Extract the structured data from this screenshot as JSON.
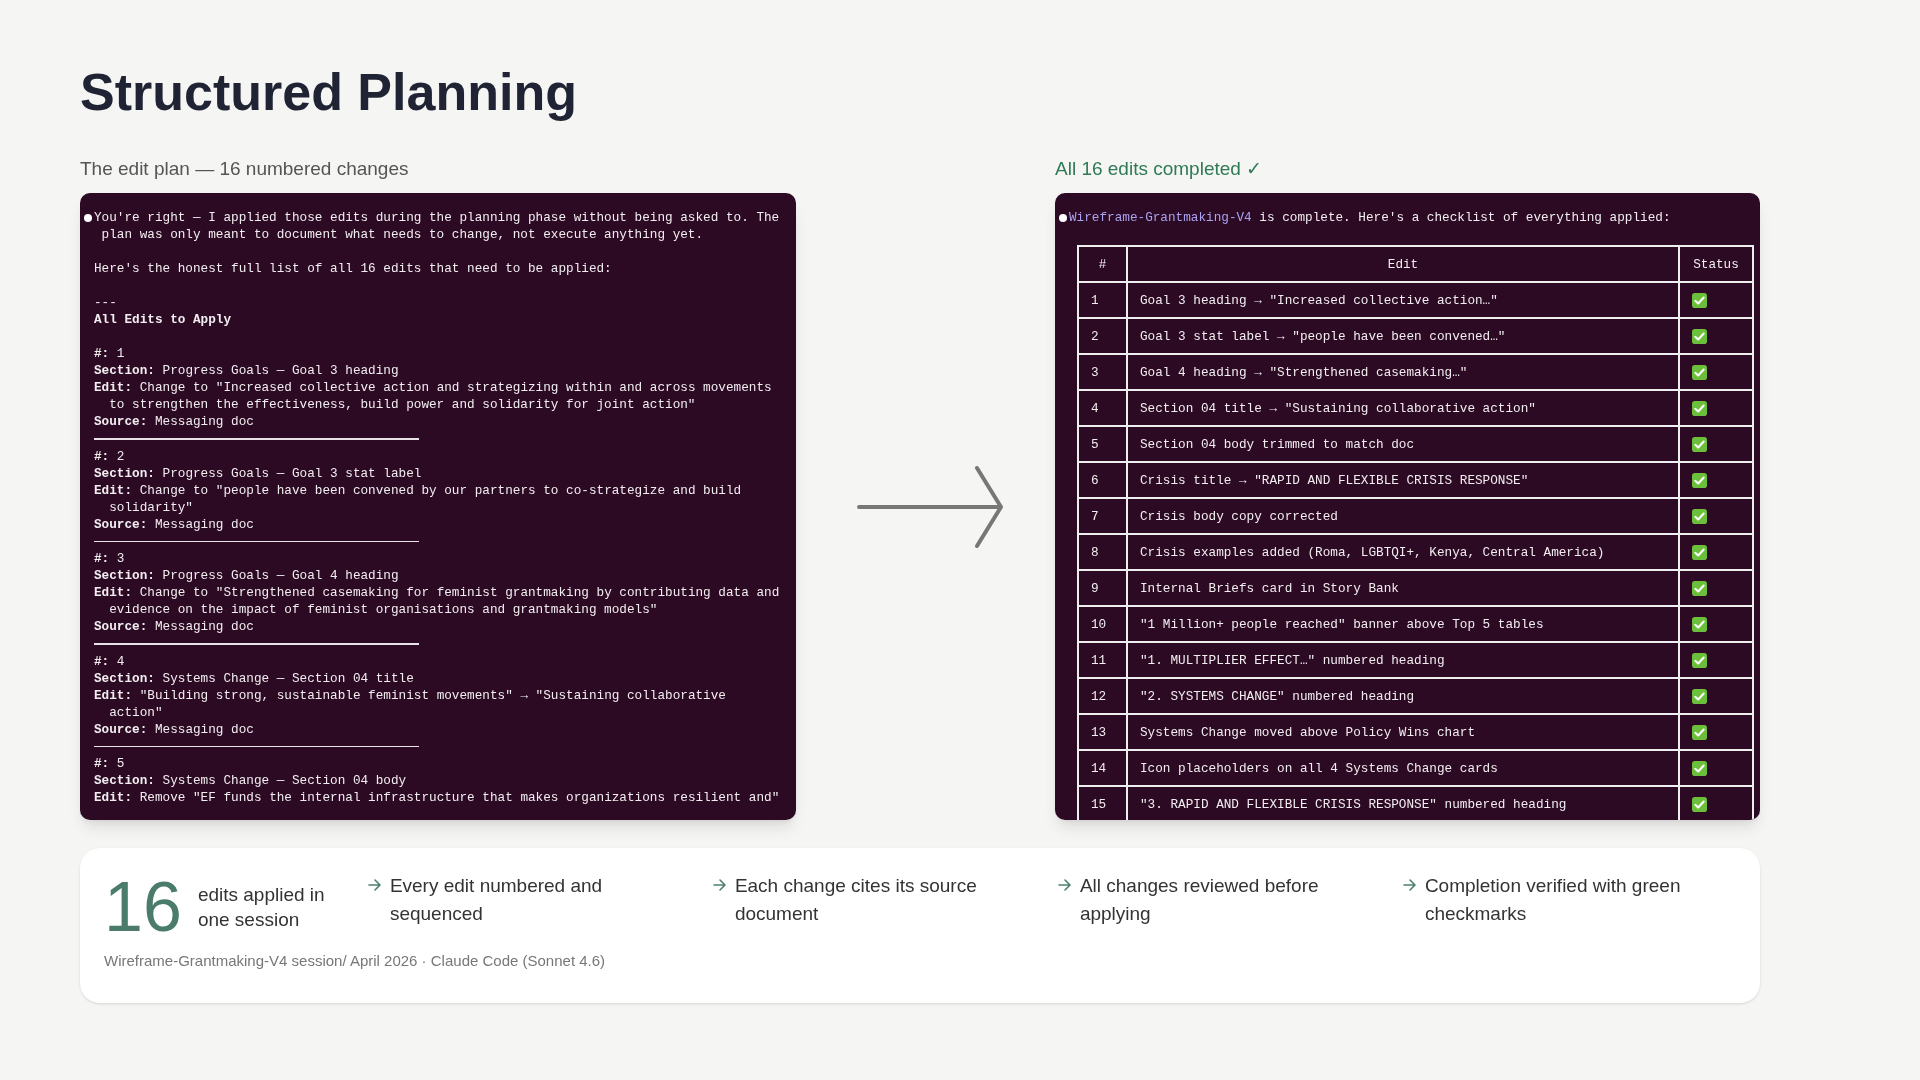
{
  "title": "Structured Planning",
  "left_panel": {
    "caption": "The edit plan — 16 numbered changes",
    "intro": [
      "You're right — I applied those edits during the planning phase without being asked to. The plan was only meant to document what needs to change, not execute anything yet.",
      "Here's the honest full list of all 16 edits that need to be applied:"
    ],
    "rule_text": "---",
    "heading": "All Edits to Apply",
    "edits": [
      {
        "fields": [
          {
            "label": "#:",
            "value": "1"
          },
          {
            "label": "Section:",
            "value": "Progress Goals — Goal 3 heading"
          },
          {
            "label": "Edit:",
            "value": "Change to \"Increased collective action and strategizing within and across movements to strengthen the effectiveness, build power and solidarity for joint action\""
          },
          {
            "label": "Source:",
            "value": "Messaging doc"
          }
        ]
      },
      {
        "fields": [
          {
            "label": "#:",
            "value": "2"
          },
          {
            "label": "Section:",
            "value": "Progress Goals — Goal 3 stat label"
          },
          {
            "label": "Edit:",
            "value": "Change to \"people have been convened by our partners to co-strategize and build solidarity\""
          },
          {
            "label": "Source:",
            "value": "Messaging doc"
          }
        ]
      },
      {
        "fields": [
          {
            "label": "#:",
            "value": "3"
          },
          {
            "label": "Section:",
            "value": "Progress Goals — Goal 4 heading"
          },
          {
            "label": "Edit:",
            "value": "Change to \"Strengthened casemaking for feminist grantmaking by contributing data and evidence on the impact of feminist organisations and grantmaking models\""
          },
          {
            "label": "Source:",
            "value": "Messaging doc"
          }
        ]
      },
      {
        "fields": [
          {
            "label": "#:",
            "value": "4"
          },
          {
            "label": "Section:",
            "value": "Systems Change — Section 04 title"
          },
          {
            "label": "Edit:",
            "value": "\"Building strong, sustainable feminist movements\" → \"Sustaining collaborative action\""
          },
          {
            "label": "Source:",
            "value": "Messaging doc"
          }
        ]
      },
      {
        "fields": [
          {
            "label": "#:",
            "value": "5"
          },
          {
            "label": "Section:",
            "value": "Systems Change — Section 04 body"
          },
          {
            "label": "Edit:",
            "value": "Remove \"EF funds the internal infrastructure that makes organizations resilient and\""
          }
        ]
      }
    ]
  },
  "right_panel": {
    "caption": "All 16 edits completed ✓",
    "file": "Wireframe-Grantmaking-V4",
    "message": "is complete. Here's a checklist of everything applied:",
    "columns": [
      "#",
      "Edit",
      "Status"
    ],
    "rows": [
      {
        "number": "1",
        "edit": "Goal 3 heading → \"Increased collective action…\"",
        "done": true
      },
      {
        "number": "2",
        "edit": "Goal 3 stat label → \"people have been convened…\"",
        "done": true
      },
      {
        "number": "3",
        "edit": "Goal 4 heading → \"Strengthened casemaking…\"",
        "done": true
      },
      {
        "number": "4",
        "edit": "Section 04 title → \"Sustaining collaborative action\"",
        "done": true
      },
      {
        "number": "5",
        "edit": "Section 04 body trimmed to match doc",
        "done": true
      },
      {
        "number": "6",
        "edit": "Crisis title → \"RAPID AND FLEXIBLE CRISIS RESPONSE\"",
        "done": true
      },
      {
        "number": "7",
        "edit": "Crisis body copy corrected",
        "done": true
      },
      {
        "number": "8",
        "edit": "Crisis examples added (Roma, LGBTQI+, Kenya, Central America)",
        "done": true
      },
      {
        "number": "9",
        "edit": "Internal Briefs card in Story Bank",
        "done": true
      },
      {
        "number": "10",
        "edit": "\"1 Million+ people reached\" banner above Top 5 tables",
        "done": true
      },
      {
        "number": "11",
        "edit": "\"1. MULTIPLIER EFFECT…\" numbered heading",
        "done": true
      },
      {
        "number": "12",
        "edit": "\"2. SYSTEMS CHANGE\" numbered heading",
        "done": true
      },
      {
        "number": "13",
        "edit": "Systems Change moved above Policy Wins chart",
        "done": true
      },
      {
        "number": "14",
        "edit": "Icon placeholders on all 4 Systems Change cards",
        "done": true
      },
      {
        "number": "15",
        "edit": "\"3. RAPID AND FLEXIBLE CRISIS RESPONSE\" numbered heading",
        "done": true
      }
    ]
  },
  "summary": {
    "count": "16",
    "count_label": "edits applied in one session",
    "features": [
      "Every edit numbered and sequenced",
      "Each change cites its source document",
      "All changes reviewed before applying",
      "Completion verified with green checkmarks"
    ],
    "footer": "Wireframe-Grantmaking-V4 session/ April 2026 · Claude Code (Sonnet 4.6)"
  }
}
